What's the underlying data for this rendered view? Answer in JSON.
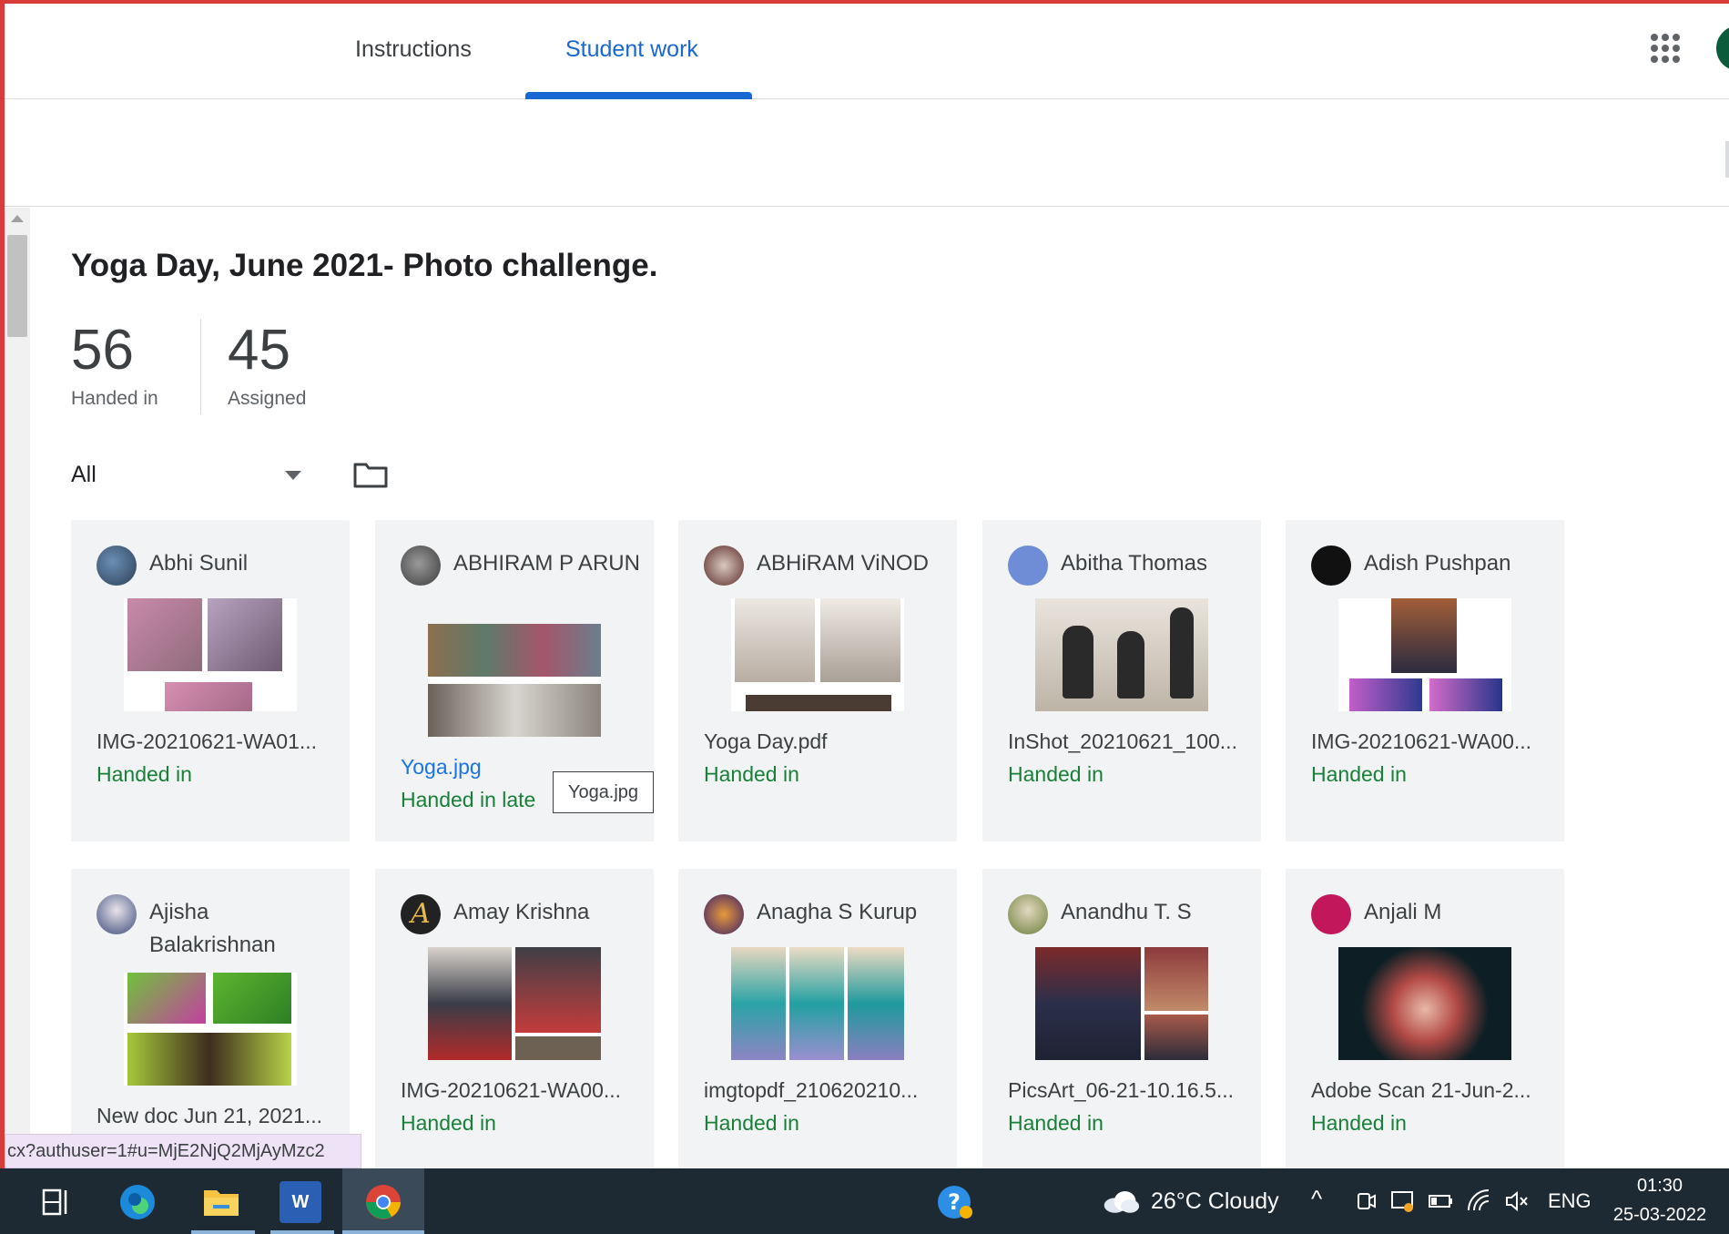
{
  "tabs": [
    {
      "label": "Instructions",
      "active": false
    },
    {
      "label": "Student work",
      "active": true
    }
  ],
  "accent_color": "#1967d2",
  "status_color": "#188038",
  "assignment": {
    "title": "Yoga Day, June 2021- Photo challenge.",
    "handed_in_count": "56",
    "handed_in_label": "Handed in",
    "assigned_count": "45",
    "assigned_label": "Assigned"
  },
  "filter": {
    "selected": "All"
  },
  "students": [
    {
      "name": "Abhi Sunil",
      "file": "IMG-20210621-WA01...",
      "status": "Handed in"
    },
    {
      "name": "ABHIRAM P ARUN",
      "file": "Yoga.jpg",
      "status": "Handed in late"
    },
    {
      "name": "ABHiRAM ViNOD",
      "file": "Yoga Day.pdf",
      "status": "Handed in"
    },
    {
      "name": "Abitha Thomas",
      "file": "InShot_20210621_100...",
      "status": "Handed in"
    },
    {
      "name": "Adish Pushpan",
      "file": "IMG-20210621-WA00...",
      "status": "Handed in"
    },
    {
      "name": "Ajisha Balakrishnan",
      "file": "New doc Jun 21, 2021...",
      "status": ""
    },
    {
      "name": "Amay Krishna",
      "file": "IMG-20210621-WA00...",
      "status": "Handed in"
    },
    {
      "name": "Anagha S Kurup",
      "file": "imgtopdf_210620210...",
      "status": "Handed in"
    },
    {
      "name": "Anandhu T. S",
      "file": "PicsArt_06-21-10.16.5...",
      "status": "Handed in"
    },
    {
      "name": "Anjali M",
      "file": "Adobe Scan 21-Jun-2...",
      "status": "Handed in"
    }
  ],
  "tooltip": "Yoga.jpg",
  "url_hint": "cx?authuser=1#u=MjE2NjQ2MjAyMzc2",
  "taskbar": {
    "weather": "26°C  Cloudy",
    "language": "ENG",
    "time": "01:30",
    "date": "25-03-2022",
    "word_label": "W"
  },
  "icons": [
    "apps-grid-icon",
    "folder-icon",
    "dropdown-caret-icon",
    "task-view-icon",
    "edge-icon",
    "file-explorer-icon",
    "word-icon",
    "chrome-icon",
    "help-icon",
    "cloud-icon"
  ]
}
